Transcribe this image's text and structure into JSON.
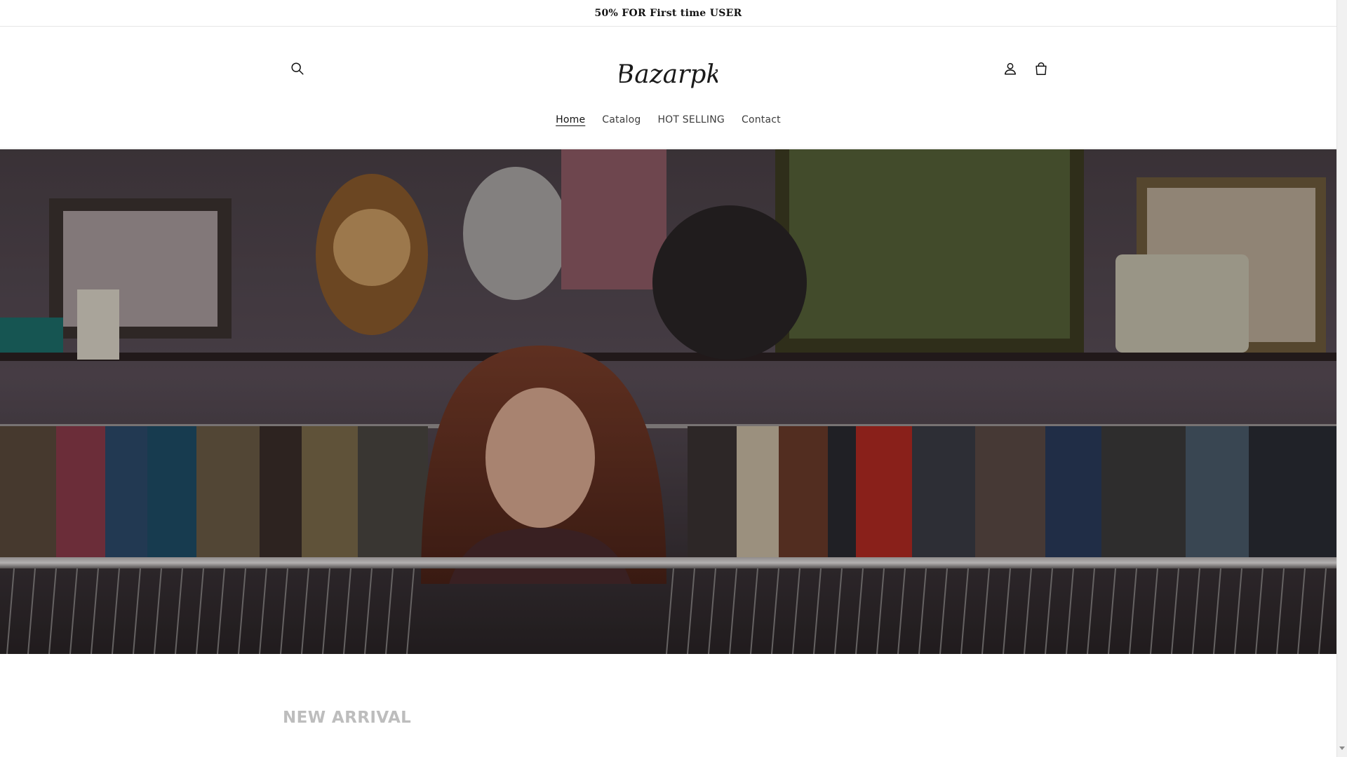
{
  "announcement": {
    "text": "50% FOR First time USER"
  },
  "header": {
    "logo_text": "Bazarpk",
    "icons": {
      "search": "search-icon",
      "account": "user-icon",
      "cart": "cart-icon"
    }
  },
  "nav": {
    "items": [
      {
        "label": "Home",
        "active": true
      },
      {
        "label": "Catalog",
        "active": false
      },
      {
        "label": "HOT SELLING",
        "active": false
      },
      {
        "label": "Contact",
        "active": false
      }
    ]
  },
  "hero": {
    "image": "thrift-store-hero-image"
  },
  "section": {
    "title": "NEW ARRIVAL"
  },
  "colors": {
    "text": "#121212",
    "muted_title": "#bdbdbd",
    "hero_bg": "#3a3236"
  }
}
